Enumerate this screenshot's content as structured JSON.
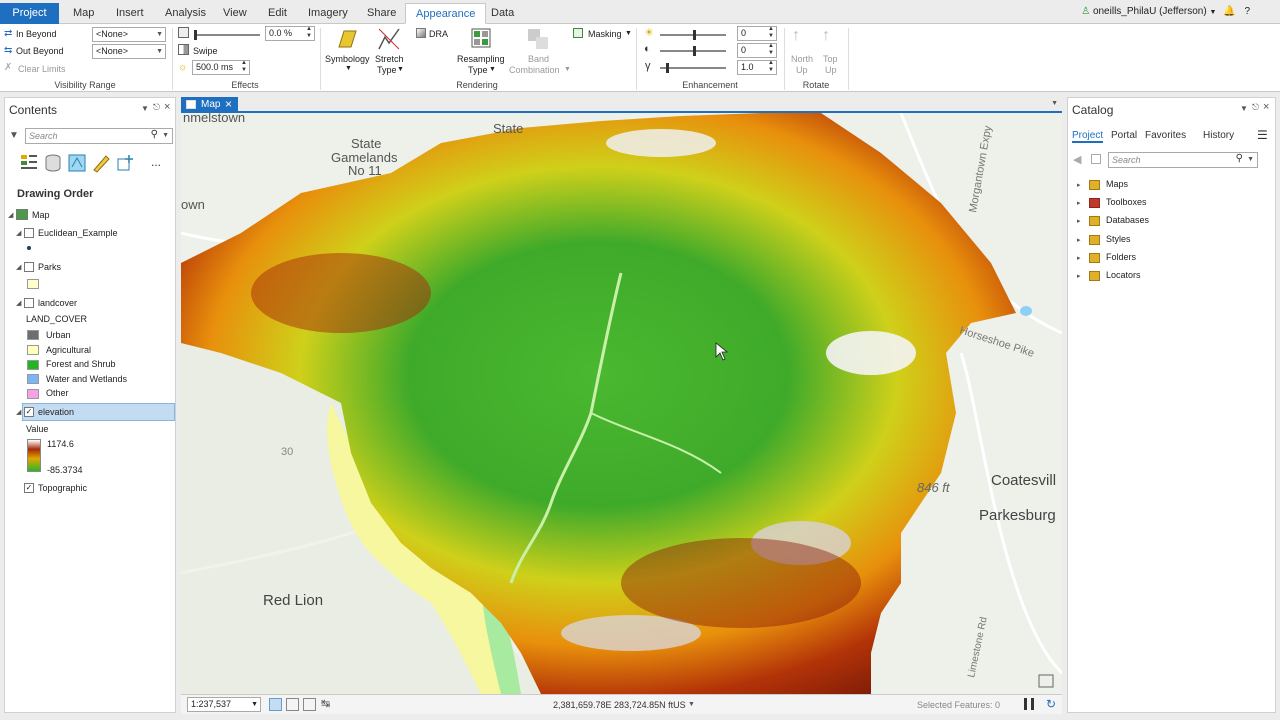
{
  "tabs": [
    {
      "label": "Project"
    },
    {
      "label": "Map"
    },
    {
      "label": "Insert"
    },
    {
      "label": "Analysis"
    },
    {
      "label": "View"
    },
    {
      "label": "Edit"
    },
    {
      "label": "Imagery"
    },
    {
      "label": "Share"
    },
    {
      "label": "Appearance"
    },
    {
      "label": "Data"
    }
  ],
  "user": {
    "name": "oneills_PhilaU (Jefferson)",
    "help": "?"
  },
  "ribbon": {
    "visibility": {
      "in_beyond": "In Beyond",
      "out_beyond": "Out Beyond",
      "clear_limits": "Clear Limits",
      "in_value": "<None>",
      "out_value": "<None>",
      "label": "Visibility Range"
    },
    "effects": {
      "transparency": "0.0 %",
      "swipe": "Swipe",
      "flicker": "500.0 ms",
      "label": "Effects"
    },
    "rendering": {
      "symbology": "Symbology",
      "stretch": "Stretch",
      "stretch_type": "Type",
      "dra": "DRA",
      "resampling": "Resampling",
      "resampling_type": "Type",
      "band": "Band",
      "band_combination": "Combination",
      "masking": "Masking",
      "label": "Rendering"
    },
    "enhancement": {
      "brightness": "0",
      "contrast": "0",
      "gamma": "1.0",
      "label": "Enhancement"
    },
    "rotate": {
      "north": "North",
      "north_up": "Up",
      "top": "Top",
      "top_up": "Up",
      "label": "Rotate"
    }
  },
  "contents": {
    "title": "Contents",
    "search_placeholder": "Search",
    "more": "...",
    "drawing_order": "Drawing Order",
    "map": "Map",
    "layers": {
      "euclidean": "Euclidean_Example",
      "parks": "Parks",
      "landcover": "landcover",
      "land_cover_field": "LAND_COVER",
      "classes": [
        {
          "label": "Urban",
          "color": "#6e6e6e"
        },
        {
          "label": "Agricultural",
          "color": "#ffffbe"
        },
        {
          "label": "Forest and Shrub",
          "color": "#21b521"
        },
        {
          "label": "Water and Wetlands",
          "color": "#7ab6f5"
        },
        {
          "label": "Other",
          "color": "#f5a3e6"
        }
      ],
      "elevation": "elevation",
      "value": "Value",
      "high": "1174.6",
      "low": "-85.3734",
      "topographic": "Topographic"
    }
  },
  "map_tab": {
    "label": "Map",
    "close": "×"
  },
  "map_labels": {
    "mlstown": "nmelstown",
    "state1": "State",
    "gamelands": "Gamelands",
    "no": "No 11",
    "state2": "State",
    "own": "own",
    "exp": "Morgantown Expy",
    "horseshoe": "Horseshoe Pike",
    "r30": "30",
    "ft846": "846 ft",
    "coatesville": "Coatesvill",
    "parkesburg": "Parkesburg",
    "redlion": "Red Lion",
    "limestone": "Limestone Rd"
  },
  "status": {
    "scale": "1:237,537",
    "coords": "2,381,659.78E 283,724.85N ftUS",
    "selected": "Selected Features: 0"
  },
  "catalog": {
    "title": "Catalog",
    "tabs": [
      "Project",
      "Portal",
      "Favorites",
      "History"
    ],
    "search_placeholder": "Search",
    "items": [
      "Maps",
      "Toolboxes",
      "Databases",
      "Styles",
      "Folders",
      "Locators"
    ]
  }
}
